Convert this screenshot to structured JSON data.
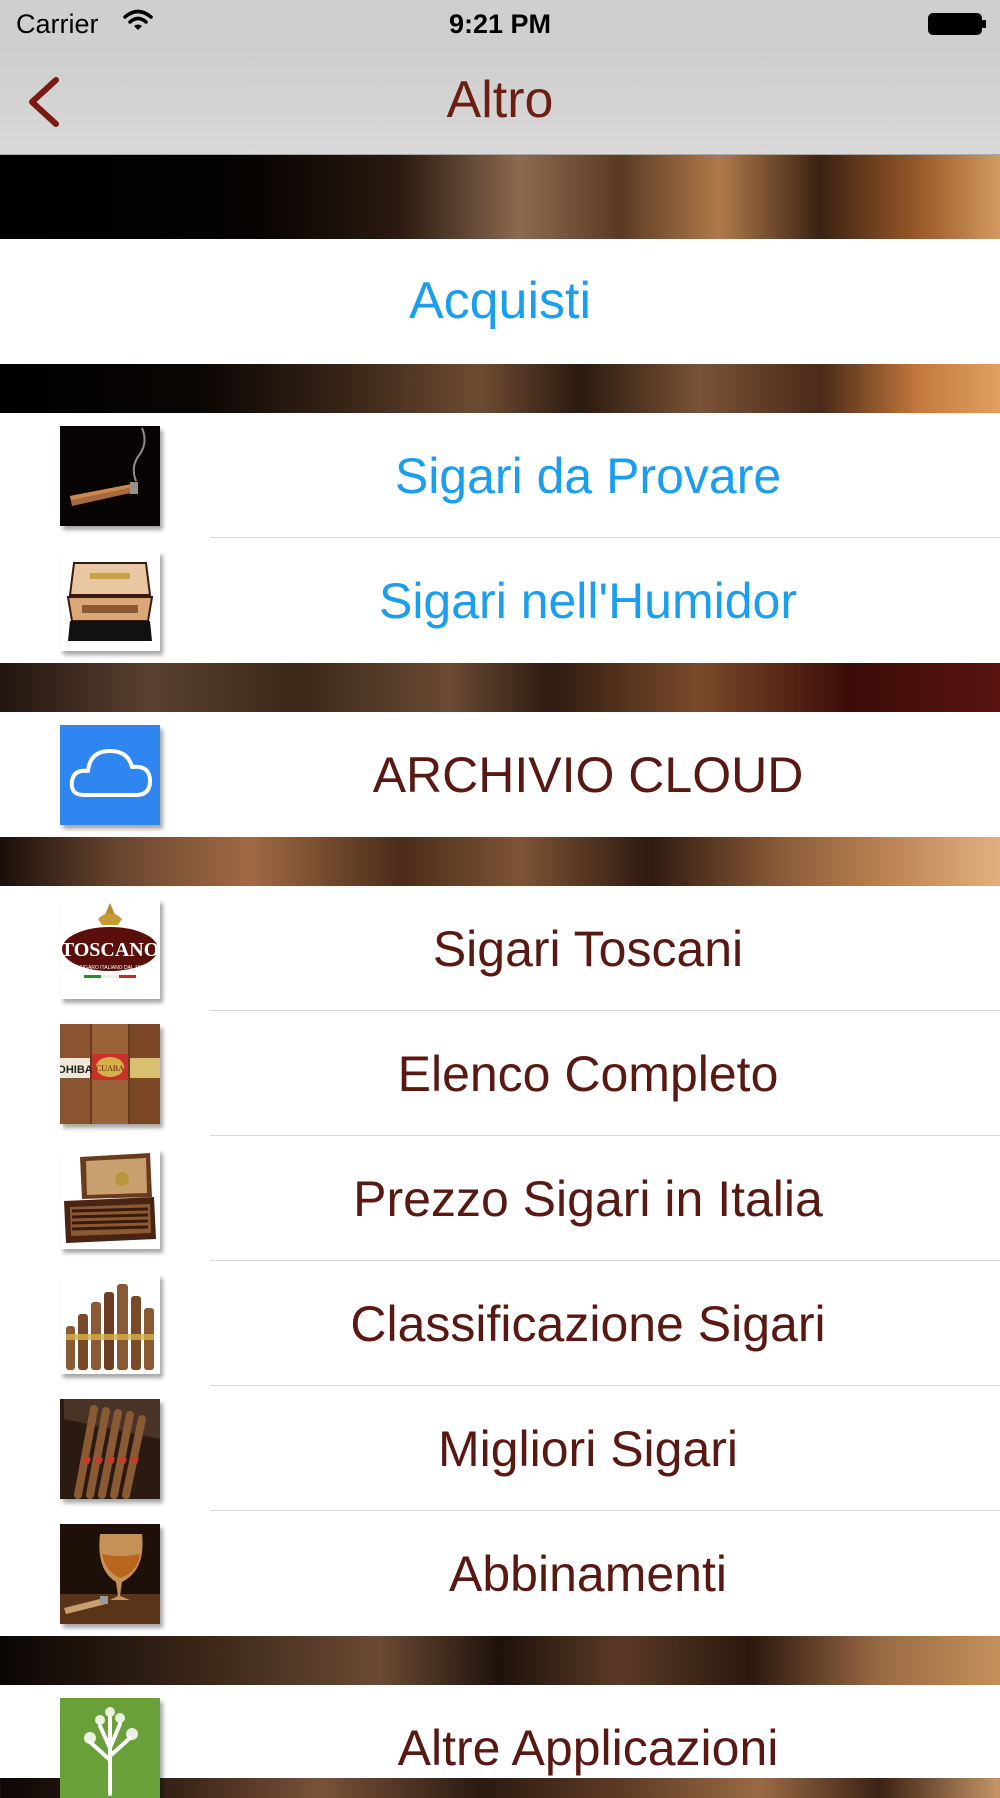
{
  "status_bar": {
    "carrier": "Carrier",
    "time": "9:21 PM"
  },
  "navbar": {
    "title": "Altro",
    "back_icon": "chevron-left-icon"
  },
  "purchases": {
    "label": "Acquisti"
  },
  "section_personal": [
    {
      "label": "Sigari da Provare",
      "icon": "cigar-smoke-icon"
    },
    {
      "label": "Sigari nell'Humidor",
      "icon": "humidor-icon"
    }
  ],
  "cloud": {
    "label": "ARCHIVIO CLOUD",
    "icon": "cloud-icon"
  },
  "section_catalog": [
    {
      "label": "Sigari Toscani",
      "icon": "toscano-logo"
    },
    {
      "label": "Elenco Completo",
      "icon": "cigar-bands-icon"
    },
    {
      "label": "Prezzo Sigari in Italia",
      "icon": "cigar-box-icon"
    },
    {
      "label": "Classificazione Sigari",
      "icon": "cigar-sizes-icon"
    },
    {
      "label": "Migliori Sigari",
      "icon": "cigar-set-icon"
    },
    {
      "label": "Abbinamenti",
      "icon": "brandy-glass-icon"
    }
  ],
  "toscano_logo": {
    "brand": "TOSCANO",
    "tagline": "IL SIGARO ITALIANO DAL 1818"
  },
  "cigar_bands": {
    "left": "OHIBA",
    "center": "CUABA"
  },
  "other_apps": {
    "label": "Altre Applicazioni",
    "icon": "tree-icon"
  },
  "colors": {
    "accent_blue": "#1a9ef0",
    "text_brown": "#5a1812",
    "title_brown": "#6b1e12",
    "cloud_blue": "#2f86f0"
  }
}
